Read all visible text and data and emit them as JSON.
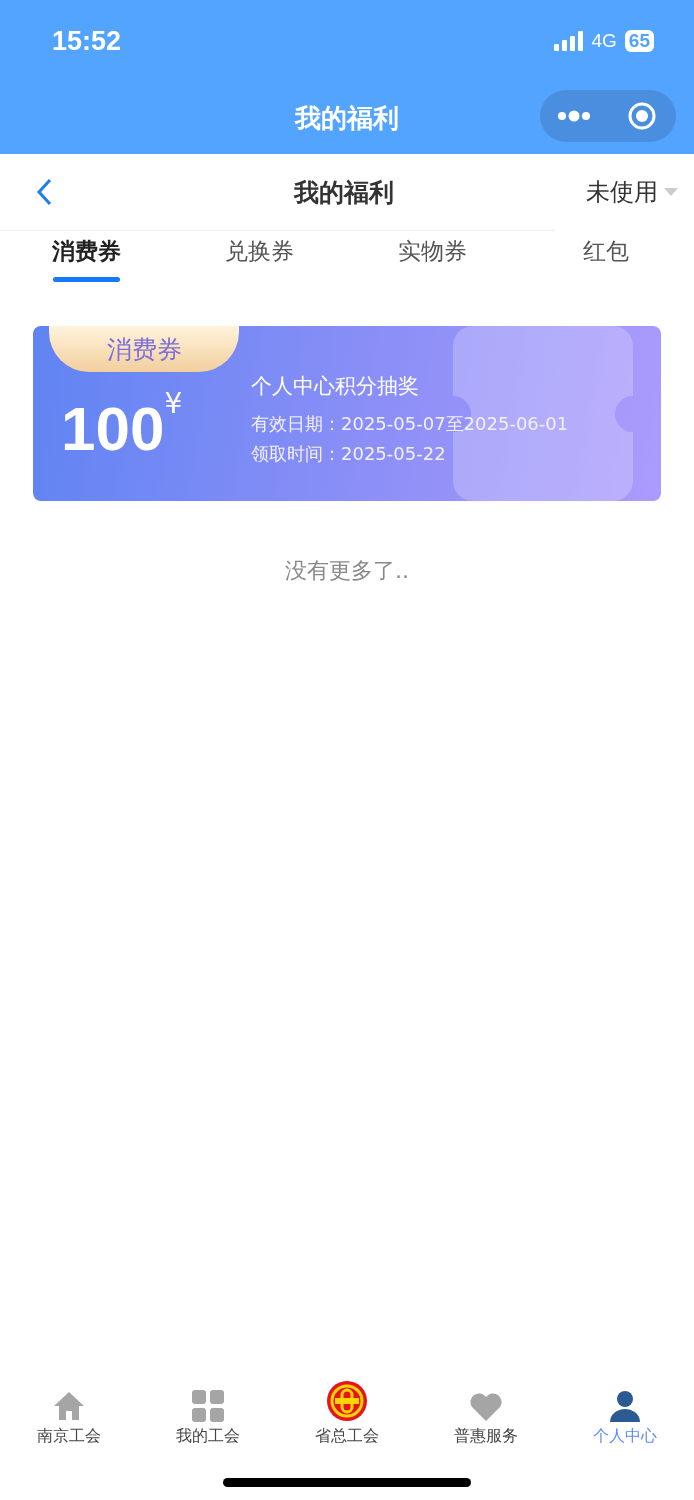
{
  "status_bar": {
    "time": "15:52",
    "network": "4G",
    "battery": "65"
  },
  "nav_bar": {
    "title": "我的福利"
  },
  "header": {
    "title": "我的福利",
    "filter": "未使用"
  },
  "tabs": [
    {
      "label": "消费券",
      "selected": true
    },
    {
      "label": "兑换券",
      "selected": false
    },
    {
      "label": "实物券",
      "selected": false
    },
    {
      "label": "红包",
      "selected": false
    }
  ],
  "coupons": [
    {
      "tag": "消费券",
      "amount": "100",
      "currency": "¥",
      "name": "个人中心积分抽奖",
      "validity": "有效日期：2025-05-07至2025-06-01",
      "received": "领取时间：2025-05-22"
    }
  ],
  "end_note": "没有更多了..",
  "tab_bar": [
    {
      "label": "南京工会",
      "kind": "home",
      "selected": false
    },
    {
      "label": "我的工会",
      "kind": "grid",
      "selected": false
    },
    {
      "label": "省总工会",
      "kind": "emblem",
      "selected": false
    },
    {
      "label": "普惠服务",
      "kind": "heart",
      "selected": false
    },
    {
      "label": "个人中心",
      "kind": "person",
      "selected": true
    }
  ]
}
